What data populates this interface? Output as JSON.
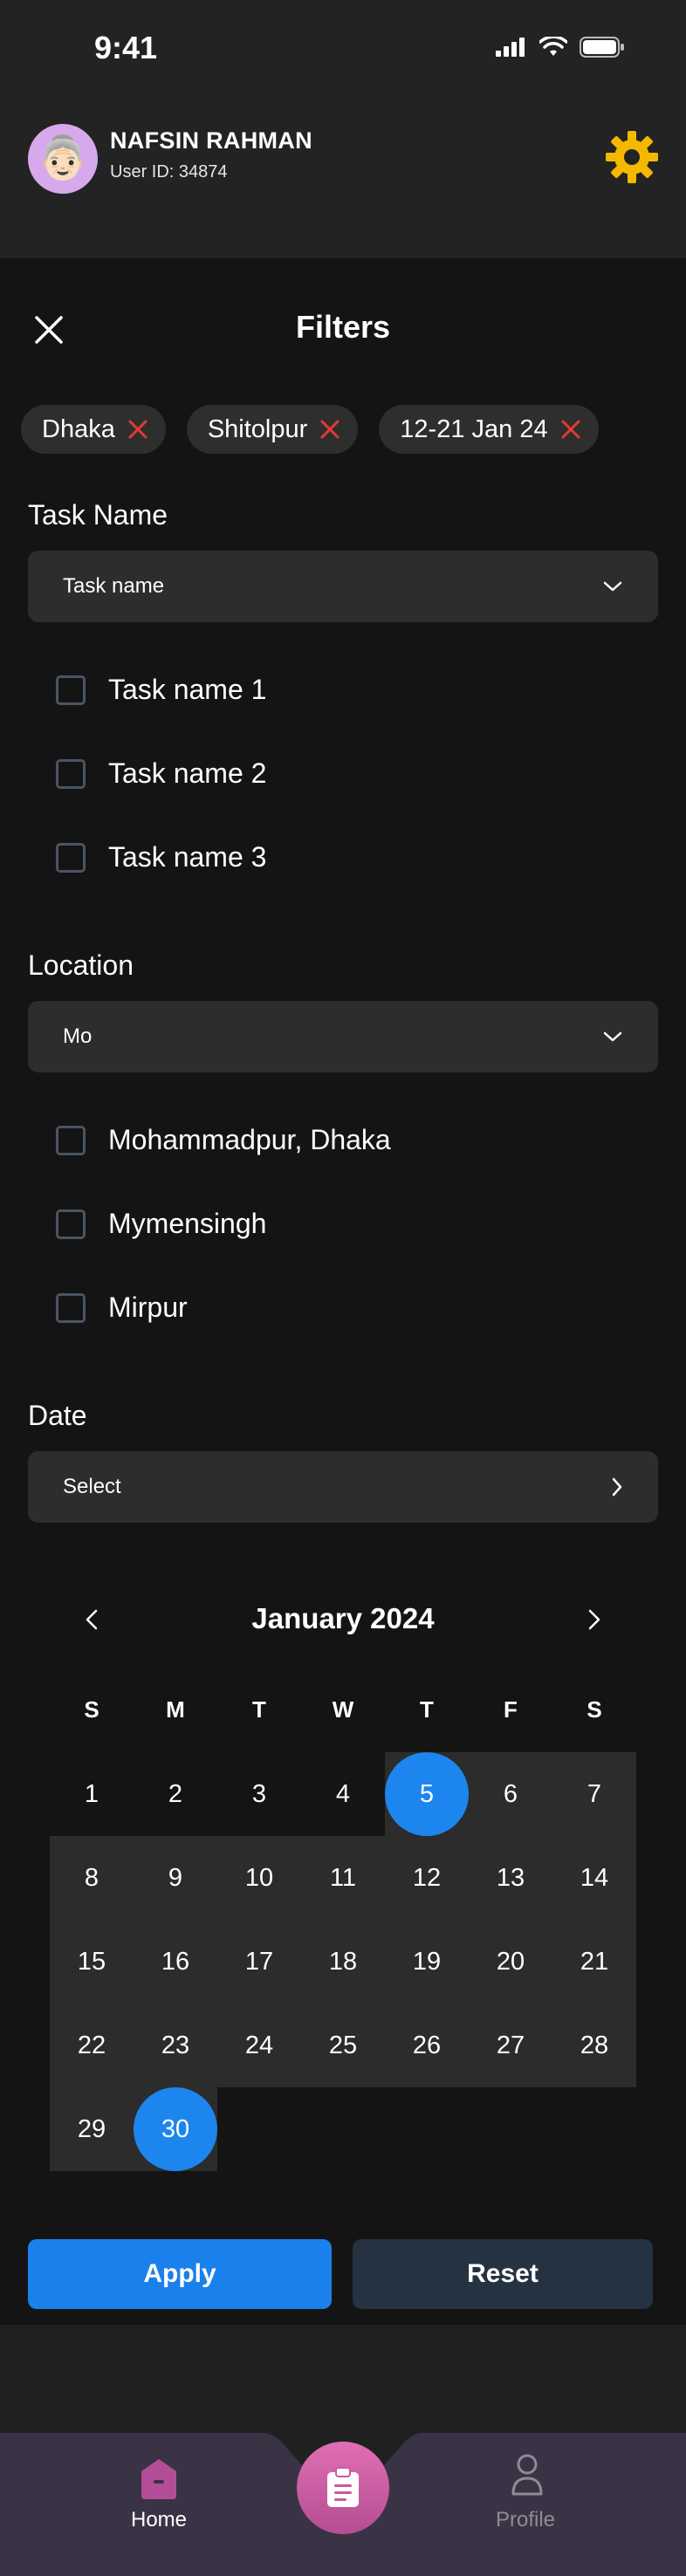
{
  "status_bar": {
    "time": "9:41"
  },
  "header": {
    "user_name": "NAFSIN RAHMAN",
    "user_id": "User ID: 34874",
    "avatar_emoji": "👵🏻"
  },
  "filters": {
    "title": "Filters",
    "chips": [
      "Dhaka",
      "Shitolpur",
      "12-21 Jan 24"
    ],
    "task_name": {
      "label": "Task Name",
      "dropdown_value": "Task name",
      "options": [
        "Task name 1",
        "Task name 2",
        "Task name 3"
      ]
    },
    "location": {
      "label": "Location",
      "dropdown_value": "Mo",
      "options": [
        "Mohammadpur, Dhaka",
        "Mymensingh",
        "Mirpur"
      ]
    },
    "date": {
      "label": "Date",
      "select_value": "Select"
    }
  },
  "calendar": {
    "month_label": "January 2024",
    "weekdays": [
      "S",
      "M",
      "T",
      "W",
      "T",
      "F",
      "S"
    ],
    "days": [
      1,
      2,
      3,
      4,
      5,
      6,
      7,
      8,
      9,
      10,
      11,
      12,
      13,
      14,
      15,
      16,
      17,
      18,
      19,
      20,
      21,
      22,
      23,
      24,
      25,
      26,
      27,
      28,
      29,
      30
    ],
    "first_weekday_index": 0,
    "selected_start": 5,
    "selected_end": 30
  },
  "actions": {
    "apply": "Apply",
    "reset": "Reset"
  },
  "nav": {
    "home": "Home",
    "profile": "Profile"
  },
  "colors": {
    "accent_blue": "#1c86ee",
    "reset_bg": "#253241",
    "chip_remove": "#e53935",
    "gear": "#f5b800",
    "fab": "#c95aa3"
  }
}
